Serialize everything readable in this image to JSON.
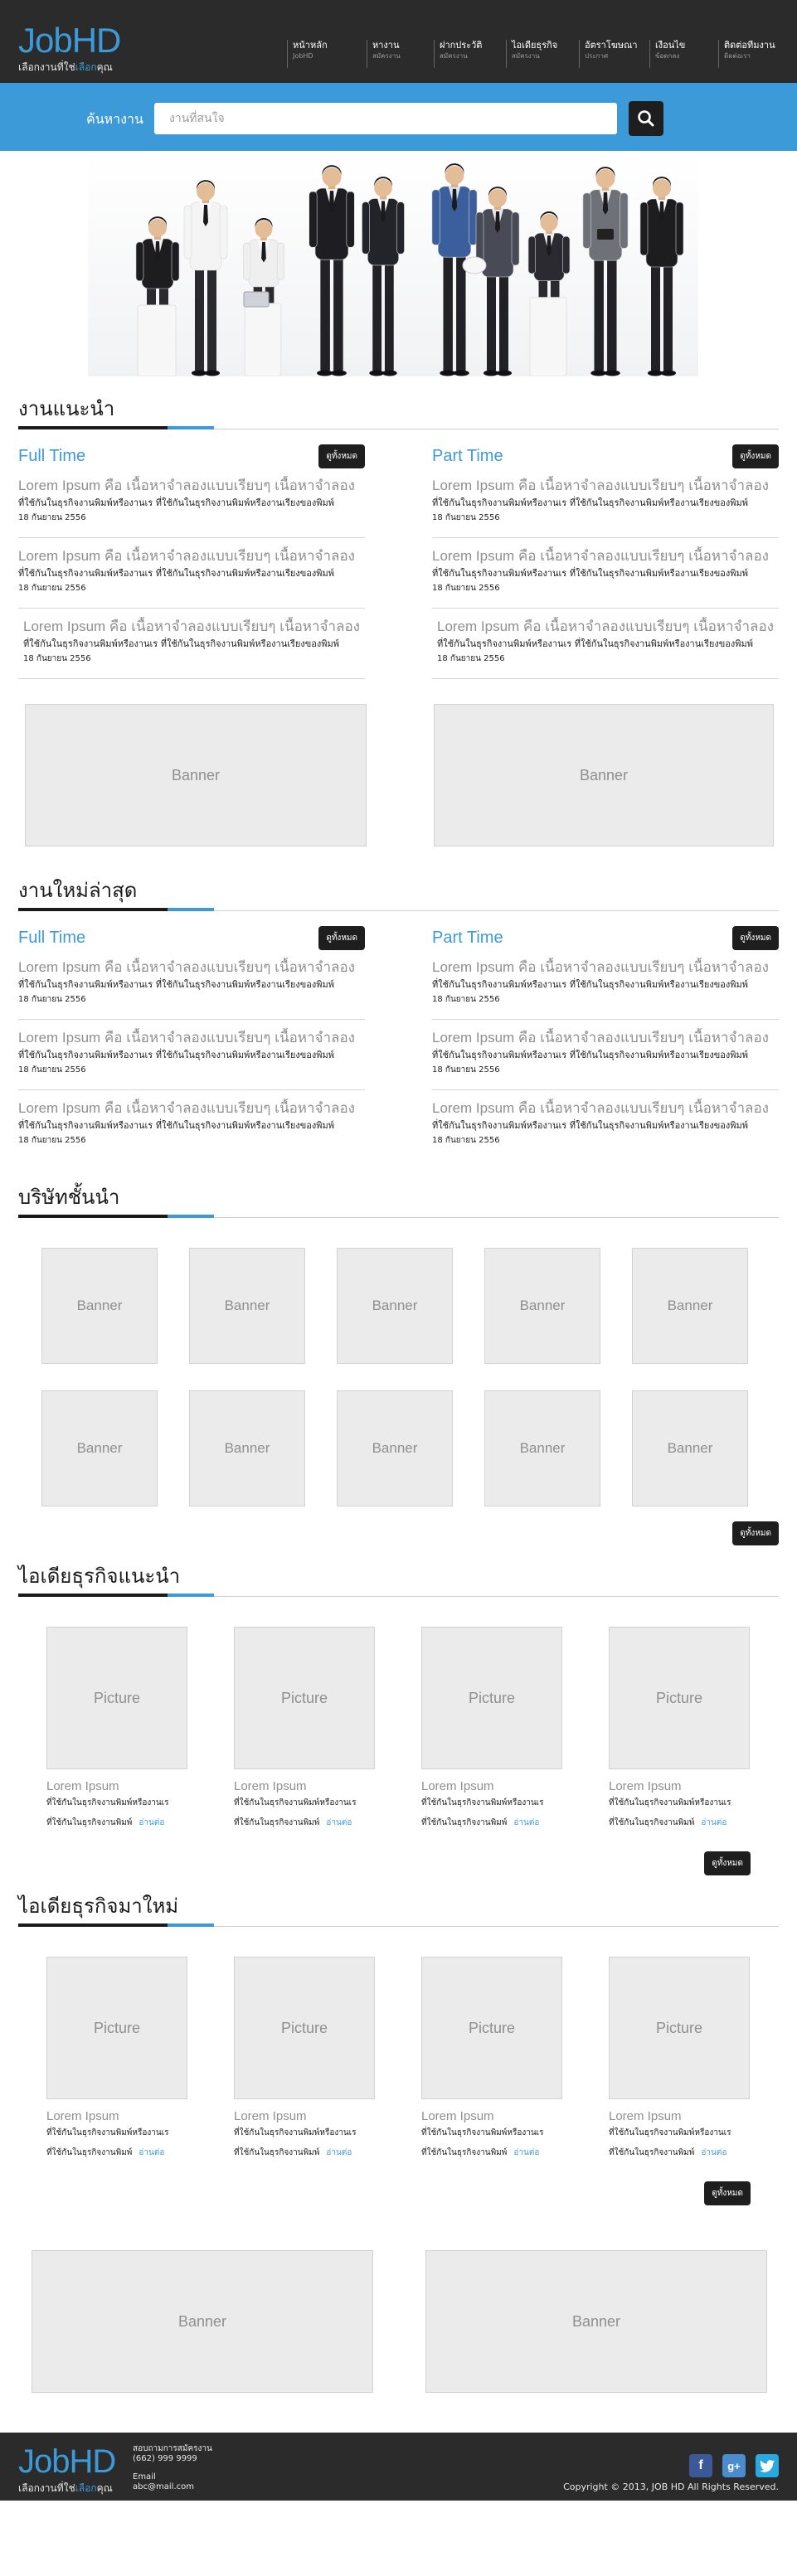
{
  "brand": {
    "logo": "JobHD",
    "tagline_pre": "เลือกงานที่ใช่",
    "tagline_hl": "เลือก",
    "tagline_post": "คุณ"
  },
  "nav": [
    {
      "label": "หน้าหลัก",
      "sub": "JobHD"
    },
    {
      "label": "หางาน",
      "sub": "สมัครงาน"
    },
    {
      "label": "ฝากประวัติ",
      "sub": "สมัครงาน"
    },
    {
      "label": "ไอเดียธุรกิจ",
      "sub": "สมัครงาน"
    },
    {
      "label": "อัตราโฆษณา",
      "sub": "ประกาศ"
    },
    {
      "label": "เงื่อนไข",
      "sub": "ข้อตกลง"
    },
    {
      "label": "ติดต่อทีมงาน",
      "sub": "ติดต่อเรา"
    }
  ],
  "search": {
    "label": "ค้นหางาน",
    "placeholder": "งานที่สนใจ",
    "icon": "search-icon"
  },
  "common": {
    "view_all": "ดูทั้งหมด",
    "banner": "Banner",
    "picture": "Picture",
    "read_more": "อ่านต่อ"
  },
  "featured_jobs": {
    "title": "งานแนะนำ",
    "columns": [
      {
        "title": "Full Time",
        "jobs": [
          {
            "title": "Lorem Ipsum คือ เนื้อหาจำลองแบบเรียบๆ เนื้อหาจำลอง",
            "desc": "ที่ใช้กันในธุรกิจงานพิมพ์หรืองานเร ที่ใช้กันในธุรกิจงานพิมพ์หรืองานเรียงของพิมพ์",
            "date": "18 กันยายน 2556"
          },
          {
            "title": "Lorem Ipsum คือ เนื้อหาจำลองแบบเรียบๆ เนื้อหาจำลอง",
            "desc": "ที่ใช้กันในธุรกิจงานพิมพ์หรืองานเร ที่ใช้กันในธุรกิจงานพิมพ์หรืองานเรียงของพิมพ์",
            "date": "18 กันยายน 2556"
          },
          {
            "title": "Lorem Ipsum คือ เนื้อหาจำลองแบบเรียบๆ เนื้อหาจำลอง",
            "desc": "ที่ใช้กันในธุรกิจงานพิมพ์หรืองานเร ที่ใช้กันในธุรกิจงานพิมพ์หรืองานเรียงของพิมพ์",
            "date": "18 กันยายน 2556"
          }
        ]
      },
      {
        "title": "Part Time",
        "jobs": [
          {
            "title": "Lorem Ipsum คือ เนื้อหาจำลองแบบเรียบๆ เนื้อหาจำลอง",
            "desc": "ที่ใช้กันในธุรกิจงานพิมพ์หรืองานเร ที่ใช้กันในธุรกิจงานพิมพ์หรืองานเรียงของพิมพ์",
            "date": "18 กันยายน 2556"
          },
          {
            "title": "Lorem Ipsum คือ เนื้อหาจำลองแบบเรียบๆ เนื้อหาจำลอง",
            "desc": "ที่ใช้กันในธุรกิจงานพิมพ์หรืองานเร ที่ใช้กันในธุรกิจงานพิมพ์หรืองานเรียงของพิมพ์",
            "date": "18 กันยายน 2556"
          },
          {
            "title": "Lorem Ipsum คือ เนื้อหาจำลองแบบเรียบๆ เนื้อหาจำลอง",
            "desc": "ที่ใช้กันในธุรกิจงานพิมพ์หรืองานเร ที่ใช้กันในธุรกิจงานพิมพ์หรืองานเรียงของพิมพ์",
            "date": "18 กันยายน 2556"
          }
        ]
      }
    ]
  },
  "latest_jobs": {
    "title": "งานใหม่ล่าสุด",
    "columns": [
      {
        "title": "Full Time",
        "jobs": [
          {
            "title": "Lorem Ipsum คือ เนื้อหาจำลองแบบเรียบๆ เนื้อหาจำลอง",
            "desc": "ที่ใช้กันในธุรกิจงานพิมพ์หรืองานเร ที่ใช้กันในธุรกิจงานพิมพ์หรืองานเรียงของพิมพ์",
            "date": "18 กันยายน 2556"
          },
          {
            "title": "Lorem Ipsum คือ เนื้อหาจำลองแบบเรียบๆ เนื้อหาจำลอง",
            "desc": "ที่ใช้กันในธุรกิจงานพิมพ์หรืองานเร ที่ใช้กันในธุรกิจงานพิมพ์หรืองานเรียงของพิมพ์",
            "date": "18 กันยายน 2556"
          },
          {
            "title": "Lorem Ipsum คือ เนื้อหาจำลองแบบเรียบๆ เนื้อหาจำลอง",
            "desc": "ที่ใช้กันในธุรกิจงานพิมพ์หรืองานเร ที่ใช้กันในธุรกิจงานพิมพ์หรืองานเรียงของพิมพ์",
            "date": "18 กันยายน 2556"
          }
        ]
      },
      {
        "title": "Part Time",
        "jobs": [
          {
            "title": "Lorem Ipsum คือ เนื้อหาจำลองแบบเรียบๆ เนื้อหาจำลอง",
            "desc": "ที่ใช้กันในธุรกิจงานพิมพ์หรืองานเร ที่ใช้กันในธุรกิจงานพิมพ์หรืองานเรียงของพิมพ์",
            "date": "18 กันยายน 2556"
          },
          {
            "title": "Lorem Ipsum คือ เนื้อหาจำลองแบบเรียบๆ เนื้อหาจำลอง",
            "desc": "ที่ใช้กันในธุรกิจงานพิมพ์หรืองานเร ที่ใช้กันในธุรกิจงานพิมพ์หรืองานเรียงของพิมพ์",
            "date": "18 กันยายน 2556"
          },
          {
            "title": "Lorem Ipsum คือ เนื้อหาจำลองแบบเรียบๆ เนื้อหาจำลอง",
            "desc": "ที่ใช้กันในธุรกิจงานพิมพ์หรืองานเร ที่ใช้กันในธุรกิจงานพิมพ์หรืองานเรียงของพิมพ์",
            "date": "18 กันยายน 2556"
          }
        ]
      }
    ]
  },
  "companies": {
    "title": "บริษัทชั้นนำ"
  },
  "ideas_recommended": {
    "title": "ไอเดียธุรกิจแนะนำ",
    "items": [
      {
        "title": "Lorem Ipsum",
        "line1": "ที่ใช้กันในธุรกิจงานพิมพ์หรืองานเร",
        "line2": "ที่ใช้กันในธุรกิจงานพิมพ์"
      },
      {
        "title": "Lorem Ipsum",
        "line1": "ที่ใช้กันในธุรกิจงานพิมพ์หรืองานเร",
        "line2": "ที่ใช้กันในธุรกิจงานพิมพ์"
      },
      {
        "title": "Lorem Ipsum",
        "line1": "ที่ใช้กันในธุรกิจงานพิมพ์หรืองานเร",
        "line2": "ที่ใช้กันในธุรกิจงานพิมพ์"
      },
      {
        "title": "Lorem Ipsum",
        "line1": "ที่ใช้กันในธุรกิจงานพิมพ์หรืองานเร",
        "line2": "ที่ใช้กันในธุรกิจงานพิมพ์"
      }
    ]
  },
  "ideas_new": {
    "title": "ไอเดียธุรกิจมาใหม่",
    "items": [
      {
        "title": "Lorem Ipsum",
        "line1": "ที่ใช้กันในธุรกิจงานพิมพ์หรืองานเร",
        "line2": "ที่ใช้กันในธุรกิจงานพิมพ์"
      },
      {
        "title": "Lorem Ipsum",
        "line1": "ที่ใช้กันในธุรกิจงานพิมพ์หรืองานเร",
        "line2": "ที่ใช้กันในธุรกิจงานพิมพ์"
      },
      {
        "title": "Lorem Ipsum",
        "line1": "ที่ใช้กันในธุรกิจงานพิมพ์หรืองานเร",
        "line2": "ที่ใช้กันในธุรกิจงานพิมพ์"
      },
      {
        "title": "Lorem Ipsum",
        "line1": "ที่ใช้กันในธุรกิจงานพิมพ์หรืองานเร",
        "line2": "ที่ใช้กันในธุรกิจงานพิมพ์"
      }
    ]
  },
  "footer": {
    "contact_title": "สอบถามการสมัครงาน",
    "phone": "(662) 999 9999",
    "email_label": "Email",
    "email": "abc@mail.com",
    "copyright": "Copyright © 2013, JOB HD All Rights Reserved."
  },
  "social": [
    {
      "icon": "facebook-icon",
      "glyph": "f",
      "color": "#3b5998"
    },
    {
      "icon": "googleplus-icon",
      "glyph": "g+",
      "color": "#4b8ccf"
    },
    {
      "icon": "twitter-icon",
      "glyph": "t",
      "color": "#2aa9e0"
    }
  ],
  "colors": {
    "accent": "#3d9ad8",
    "header_bg": "#2b2b2b",
    "button_bg": "#1e1e1e"
  }
}
